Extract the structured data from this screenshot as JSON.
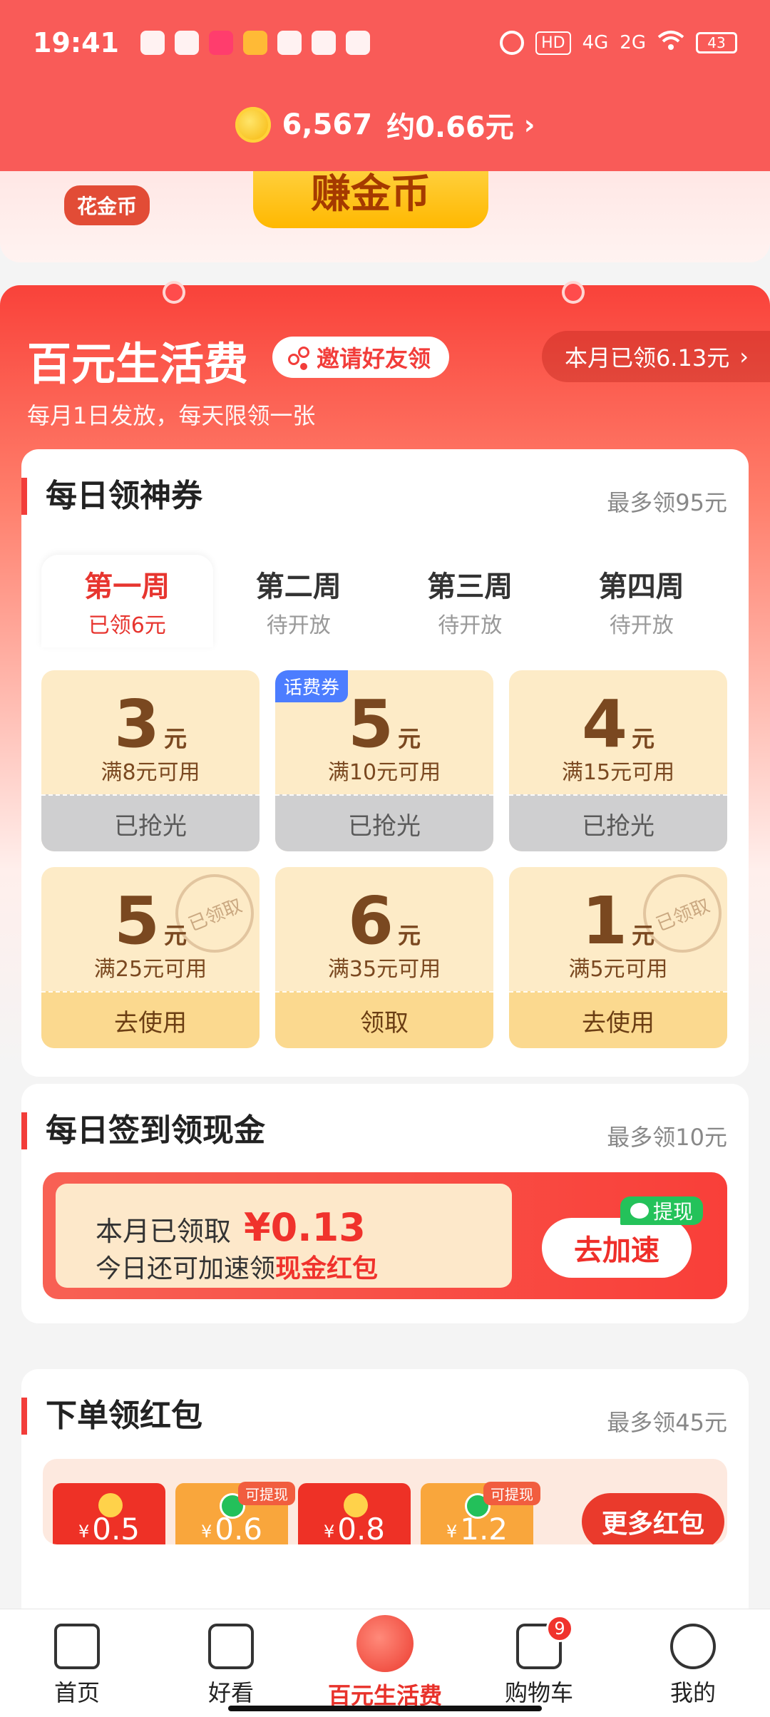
{
  "status_bar": {
    "time": "19:41",
    "network1": "4G",
    "network2": "2G",
    "battery": "43"
  },
  "coins": {
    "count": "6,567",
    "approx": "约0.66元",
    "chevron": "›"
  },
  "banner": {
    "tag": "花金币",
    "button": "赚金币"
  },
  "main": {
    "title": "百元生活费",
    "invite": "邀请好友领",
    "month_claimed": "本月已领6.13元",
    "chevron": "›",
    "subtitle": "每月1日发放，每天限领一张"
  },
  "coupons_section": {
    "title": "每日领神券",
    "max": "最多领95元",
    "weeks": [
      {
        "name": "第一周",
        "state": "已领6元"
      },
      {
        "name": "第二周",
        "state": "待开放"
      },
      {
        "name": "第三周",
        "state": "待开放"
      },
      {
        "name": "第四周",
        "state": "待开放"
      }
    ],
    "unit": "元",
    "coupons": [
      {
        "amount": "3",
        "condition": "满8元可用",
        "button": "已抢光"
      },
      {
        "amount": "5",
        "condition": "满10元可用",
        "button": "已抢光",
        "tag": "话费券"
      },
      {
        "amount": "4",
        "condition": "满15元可用",
        "button": "已抢光"
      },
      {
        "amount": "5",
        "condition": "满25元可用",
        "button": "去使用",
        "stamp": "已领取"
      },
      {
        "amount": "6",
        "condition": "满35元可用",
        "button": "领取"
      },
      {
        "amount": "1",
        "condition": "满5元可用",
        "button": "去使用",
        "stamp": "已领取"
      }
    ]
  },
  "checkin_section": {
    "title": "每日签到领现金",
    "max": "最多领10元",
    "claimed_label": "本月已领取",
    "claimed_amount": "¥0.13",
    "line2_prefix": "今日还可加速领",
    "line2_highlight": "现金红包",
    "button": "去加速",
    "withdraw_tag": "提现"
  },
  "order_section": {
    "title": "下单领红包",
    "max": "最多领45元",
    "yen": "¥",
    "packets": [
      {
        "value": "0.5"
      },
      {
        "value": "0.6",
        "tag": "可提现"
      },
      {
        "value": "0.8"
      },
      {
        "value": "1.2",
        "tag": "可提现"
      }
    ],
    "more_button": "更多红包"
  },
  "bottom_nav": {
    "items": [
      {
        "label": "首页"
      },
      {
        "label": "好看"
      },
      {
        "label": "百元生活费"
      },
      {
        "label": "购物车",
        "badge": "9"
      },
      {
        "label": "我的"
      }
    ]
  },
  "colors": {
    "primary_red": "#f95b58",
    "accent_red": "#f23d3a",
    "coupon_bg": "#fdebc7",
    "coupon_text": "#7a4820",
    "wechat_green": "#24c25a"
  }
}
